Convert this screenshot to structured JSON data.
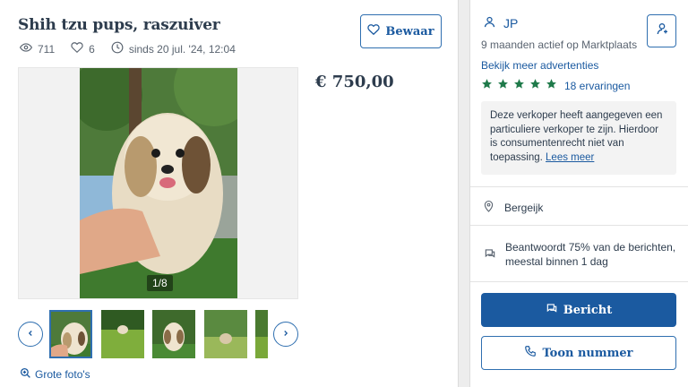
{
  "listing": {
    "title": "Shih tzu pups, raszuiver",
    "views": "711",
    "favorites": "6",
    "date": "sinds 20 jul. '24, 12:04",
    "save_label": "Bewaar",
    "price": "€ 750,00",
    "photo_counter": "1/8",
    "photos_link": "Grote foto's"
  },
  "seller": {
    "name": "JP",
    "active_since": "9 maanden actief op Marktplaats",
    "more_ads": "Bekijk meer advertenties",
    "rating_stars": 5,
    "reviews": "18 ervaringen",
    "notice": "Deze verkoper heeft aangegeven een particuliere verkoper te zijn. Hierdoor is consumentenrecht niet van toepassing.",
    "notice_link": "Lees meer",
    "location": "Bergeijk",
    "response_line1": "Beantwoordt 75% van de berichten,",
    "response_line2": "meestal binnen 1 dag"
  },
  "actions": {
    "message_label": "Bericht",
    "phone_label": "Toon nummer"
  },
  "colors": {
    "brand_blue": "#1b5aa0",
    "star_green": "#1f7a4a",
    "text": "#2d3c4d"
  },
  "icons": [
    "eye-icon",
    "heart-icon",
    "clock-icon",
    "chevron-left-icon",
    "chevron-right-icon",
    "zoom-icon",
    "user-icon",
    "follow-icon",
    "star-icon",
    "location-pin-icon",
    "chat-icon",
    "phone-icon"
  ]
}
